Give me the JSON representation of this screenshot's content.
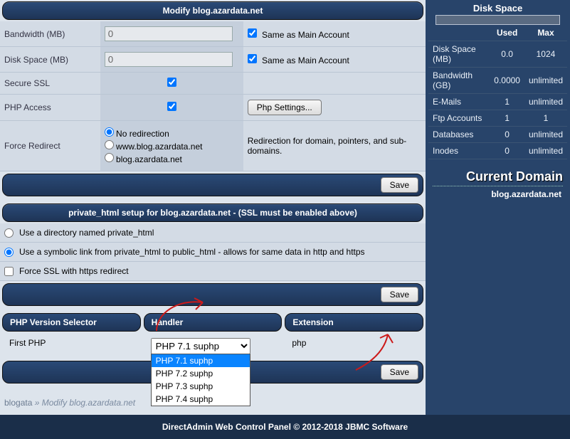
{
  "panel1": {
    "title": "Modify blog.azardata.net"
  },
  "form": {
    "bandwidth_label": "Bandwidth (MB)",
    "bandwidth_value": "0",
    "diskspace_label": "Disk Space (MB)",
    "diskspace_value": "0",
    "same_as_main": "Same as Main Account",
    "secure_ssl_label": "Secure SSL",
    "php_access_label": "PHP Access",
    "php_settings_btn": "Php Settings...",
    "force_redirect_label": "Force Redirect",
    "redir_no": "No redirection",
    "redir_www": "www.blog.azardata.net",
    "redir_blog": "blog.azardata.net",
    "redir_desc": "Redirection for domain, pointers, and sub-domains.",
    "save_btn": "Save"
  },
  "panel2": {
    "title": "private_html setup for blog.azardata.net - (SSL must be enabled above)"
  },
  "priv": {
    "opt_dir": "Use a directory named private_html",
    "opt_sym": "Use a symbolic link from private_html to public_html - allows for same data in http and https",
    "opt_force": "Force SSL with https redirect"
  },
  "php": {
    "col_selector": "PHP Version Selector",
    "col_handler": "Handler",
    "col_ext": "Extension",
    "first_label": "First PHP",
    "selected": "PHP 7.1 suphp",
    "options": [
      "PHP 7.1 suphp",
      "PHP 7.2 suphp",
      "PHP 7.3 suphp",
      "PHP 7.4 suphp"
    ],
    "ext_value": "php"
  },
  "crumb": {
    "a": "blogata",
    "sep": " » ",
    "b": "Modify blog.azardata.net"
  },
  "side": {
    "disk_hdr": "Disk Space",
    "used_hdr": "Used",
    "max_hdr": "Max",
    "rows": [
      {
        "label": "Disk Space (MB)",
        "used": "0.0",
        "max": "1024"
      },
      {
        "label": "Bandwidth (GB)",
        "used": "0.0000",
        "max": "unlimited"
      },
      {
        "label": "E-Mails",
        "used": "1",
        "max": "unlimited"
      },
      {
        "label": "Ftp Accounts",
        "used": "1",
        "max": "1"
      },
      {
        "label": "Databases",
        "used": "0",
        "max": "unlimited"
      },
      {
        "label": "Inodes",
        "used": "0",
        "max": "unlimited"
      }
    ],
    "current_domain_hdr": "Current Domain",
    "current_domain_val": "blog.azardata.net"
  },
  "footer": "DirectAdmin Web Control Panel © 2012-2018 JBMC Software"
}
